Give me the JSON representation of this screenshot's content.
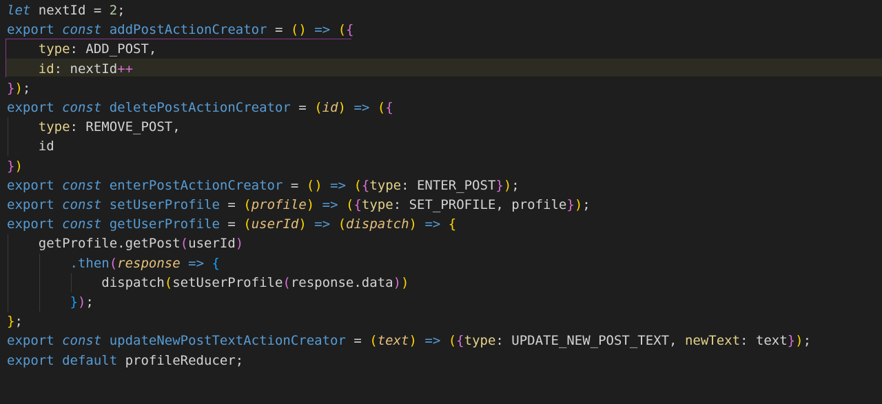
{
  "editor": {
    "lines": [
      [
        {
          "t": "let",
          "c": "st"
        },
        {
          "t": " nextId = ",
          "c": "pn"
        },
        {
          "t": "2",
          "c": "nm"
        },
        {
          "t": ";",
          "c": "pn"
        }
      ],
      [
        {
          "t": "export",
          "c": "kw"
        },
        {
          "t": " ",
          "c": "pn"
        },
        {
          "t": "const",
          "c": "st"
        },
        {
          "t": " addPostActionCreator ",
          "c": "fn"
        },
        {
          "t": "=",
          "c": "op"
        },
        {
          "t": " ",
          "c": "pn"
        },
        {
          "t": "()",
          "c": "p1"
        },
        {
          "t": " ",
          "c": "pn"
        },
        {
          "t": "=>",
          "c": "kw"
        },
        {
          "t": " ",
          "c": "pn"
        },
        {
          "t": "(",
          "c": "p1"
        },
        {
          "t": "{",
          "c": "p2"
        }
      ],
      [
        {
          "t": "    ",
          "c": "pn"
        },
        {
          "t": "type",
          "c": "ky"
        },
        {
          "t": ": ADD_POST,",
          "c": "pn"
        }
      ],
      [
        {
          "t": "    ",
          "c": "pn"
        },
        {
          "t": "id",
          "c": "ky"
        },
        {
          "t": ": nextId",
          "c": "pn"
        },
        {
          "t": "++",
          "c": "p2"
        }
      ],
      [
        {
          "t": "}",
          "c": "p2"
        },
        {
          "t": ")",
          "c": "p1"
        },
        {
          "t": ";",
          "c": "pn"
        }
      ],
      [
        {
          "t": "export",
          "c": "kw"
        },
        {
          "t": " ",
          "c": "pn"
        },
        {
          "t": "const",
          "c": "st"
        },
        {
          "t": " deletePostActionCreator ",
          "c": "fn"
        },
        {
          "t": "=",
          "c": "op"
        },
        {
          "t": " ",
          "c": "pn"
        },
        {
          "t": "(",
          "c": "p1"
        },
        {
          "t": "id",
          "c": "pr"
        },
        {
          "t": ")",
          "c": "p1"
        },
        {
          "t": " ",
          "c": "pn"
        },
        {
          "t": "=>",
          "c": "kw"
        },
        {
          "t": " ",
          "c": "pn"
        },
        {
          "t": "(",
          "c": "p1"
        },
        {
          "t": "{",
          "c": "p2"
        }
      ],
      [
        {
          "t": "    ",
          "c": "pn"
        },
        {
          "t": "type",
          "c": "ky"
        },
        {
          "t": ": REMOVE_POST,",
          "c": "pn"
        }
      ],
      [
        {
          "t": "    id",
          "c": "pn"
        }
      ],
      [
        {
          "t": "}",
          "c": "p2"
        },
        {
          "t": ")",
          "c": "p1"
        }
      ],
      [
        {
          "t": "export",
          "c": "kw"
        },
        {
          "t": " ",
          "c": "pn"
        },
        {
          "t": "const",
          "c": "st"
        },
        {
          "t": " enterPostActionCreator ",
          "c": "fn"
        },
        {
          "t": "=",
          "c": "op"
        },
        {
          "t": " ",
          "c": "pn"
        },
        {
          "t": "()",
          "c": "p1"
        },
        {
          "t": " ",
          "c": "pn"
        },
        {
          "t": "=>",
          "c": "kw"
        },
        {
          "t": " ",
          "c": "pn"
        },
        {
          "t": "(",
          "c": "p1"
        },
        {
          "t": "{",
          "c": "p2"
        },
        {
          "t": "type",
          "c": "ky"
        },
        {
          "t": ": ENTER_POST",
          "c": "pn"
        },
        {
          "t": "}",
          "c": "p2"
        },
        {
          "t": ")",
          "c": "p1"
        },
        {
          "t": ";",
          "c": "pn"
        }
      ],
      [
        {
          "t": "export",
          "c": "kw"
        },
        {
          "t": " ",
          "c": "pn"
        },
        {
          "t": "const",
          "c": "st"
        },
        {
          "t": " setUserProfile ",
          "c": "fn"
        },
        {
          "t": "=",
          "c": "op"
        },
        {
          "t": " ",
          "c": "pn"
        },
        {
          "t": "(",
          "c": "p1"
        },
        {
          "t": "profile",
          "c": "pr"
        },
        {
          "t": ")",
          "c": "p1"
        },
        {
          "t": " ",
          "c": "pn"
        },
        {
          "t": "=>",
          "c": "kw"
        },
        {
          "t": " ",
          "c": "pn"
        },
        {
          "t": "(",
          "c": "p1"
        },
        {
          "t": "{",
          "c": "p2"
        },
        {
          "t": "type",
          "c": "ky"
        },
        {
          "t": ": SET_PROFILE, profile",
          "c": "pn"
        },
        {
          "t": "}",
          "c": "p2"
        },
        {
          "t": ")",
          "c": "p1"
        },
        {
          "t": ";",
          "c": "pn"
        }
      ],
      [
        {
          "t": "export",
          "c": "kw"
        },
        {
          "t": " ",
          "c": "pn"
        },
        {
          "t": "const",
          "c": "st"
        },
        {
          "t": " getUserProfile ",
          "c": "fn"
        },
        {
          "t": "=",
          "c": "op"
        },
        {
          "t": " ",
          "c": "pn"
        },
        {
          "t": "(",
          "c": "p1"
        },
        {
          "t": "userId",
          "c": "pr"
        },
        {
          "t": ")",
          "c": "p1"
        },
        {
          "t": " ",
          "c": "pn"
        },
        {
          "t": "=>",
          "c": "kw"
        },
        {
          "t": " ",
          "c": "pn"
        },
        {
          "t": "(",
          "c": "p1"
        },
        {
          "t": "dispatch",
          "c": "pr"
        },
        {
          "t": ")",
          "c": "p1"
        },
        {
          "t": " ",
          "c": "pn"
        },
        {
          "t": "=>",
          "c": "kw"
        },
        {
          "t": " ",
          "c": "pn"
        },
        {
          "t": "{",
          "c": "p1"
        }
      ],
      [
        {
          "t": "    getProfile.getPost",
          "c": "pn"
        },
        {
          "t": "(",
          "c": "p2"
        },
        {
          "t": "userId",
          "c": "pn"
        },
        {
          "t": ")",
          "c": "p2"
        }
      ],
      [
        {
          "t": "        .then",
          "c": "fn"
        },
        {
          "t": "(",
          "c": "p2"
        },
        {
          "t": "response",
          "c": "pr"
        },
        {
          "t": " ",
          "c": "pn"
        },
        {
          "t": "=>",
          "c": "kw"
        },
        {
          "t": " ",
          "c": "pn"
        },
        {
          "t": "{",
          "c": "p3"
        }
      ],
      [
        {
          "t": "            dispatch",
          "c": "pn"
        },
        {
          "t": "(",
          "c": "p1"
        },
        {
          "t": "setUserProfile",
          "c": "pn"
        },
        {
          "t": "(",
          "c": "p2"
        },
        {
          "t": "response.data",
          "c": "pn"
        },
        {
          "t": ")",
          "c": "p2"
        },
        {
          "t": ")",
          "c": "p1"
        }
      ],
      [
        {
          "t": "        ",
          "c": "pn"
        },
        {
          "t": "}",
          "c": "p3"
        },
        {
          "t": ")",
          "c": "p2"
        },
        {
          "t": ";",
          "c": "pn"
        }
      ],
      [
        {
          "t": "}",
          "c": "p1"
        },
        {
          "t": ";",
          "c": "pn"
        }
      ],
      [
        {
          "t": "export",
          "c": "kw"
        },
        {
          "t": " ",
          "c": "pn"
        },
        {
          "t": "const",
          "c": "st"
        },
        {
          "t": " updateNewPostTextActionCreator ",
          "c": "fn"
        },
        {
          "t": "=",
          "c": "op"
        },
        {
          "t": " ",
          "c": "pn"
        },
        {
          "t": "(",
          "c": "p1"
        },
        {
          "t": "text",
          "c": "pr"
        },
        {
          "t": ")",
          "c": "p1"
        },
        {
          "t": " ",
          "c": "pn"
        },
        {
          "t": "=>",
          "c": "kw"
        },
        {
          "t": " ",
          "c": "pn"
        },
        {
          "t": "(",
          "c": "p1"
        },
        {
          "t": "{",
          "c": "p2"
        },
        {
          "t": "type",
          "c": "ky"
        },
        {
          "t": ": UPDATE_NEW_POST_TEXT, ",
          "c": "pn"
        },
        {
          "t": "newText",
          "c": "ky"
        },
        {
          "t": ": text",
          "c": "pn"
        },
        {
          "t": "}",
          "c": "p2"
        },
        {
          "t": ")",
          "c": "p1"
        },
        {
          "t": ";",
          "c": "pn"
        }
      ],
      [
        {
          "t": "export",
          "c": "kw"
        },
        {
          "t": " ",
          "c": "pn"
        },
        {
          "t": "default",
          "c": "kw"
        },
        {
          "t": " profileReducer;",
          "c": "pn"
        }
      ]
    ],
    "colors": {
      "background": "#1e1e1e",
      "keyword": "#569cd6",
      "param": "#e5c07b",
      "bracket_gold": "#ffd700",
      "bracket_magenta": "#da70d6",
      "bracket_blue": "#179fff",
      "property": "#e5d28a",
      "number": "#b5cea8",
      "current_line": "#2c2c22"
    }
  }
}
